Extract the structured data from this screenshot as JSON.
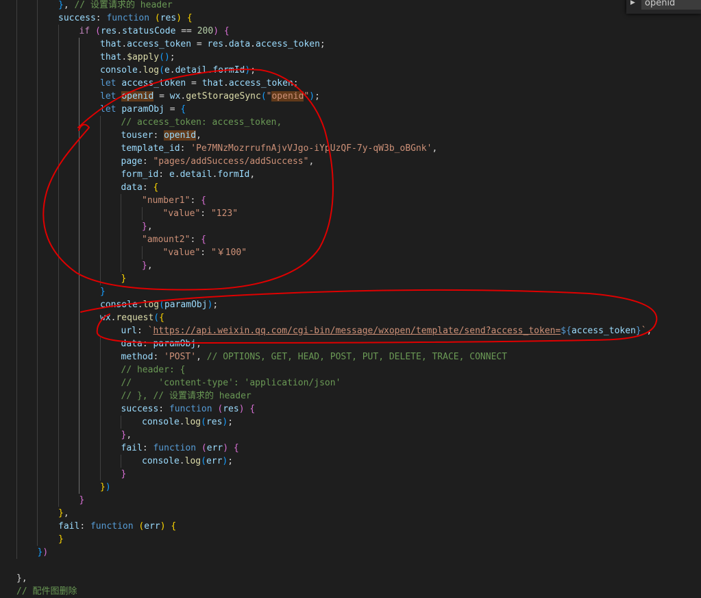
{
  "editor": {
    "lines": [
      [
        {
          "t": "}",
          "c": "br3"
        },
        {
          "t": ", ",
          "c": "pl"
        },
        {
          "t": "// 设置请求的 header",
          "c": "cmt"
        }
      ],
      [
        {
          "t": "success",
          "c": "var"
        },
        {
          "t": ": ",
          "c": "pl"
        },
        {
          "t": "function",
          "c": "kw"
        },
        {
          "t": " ",
          "c": "pl"
        },
        {
          "t": "(",
          "c": "br1"
        },
        {
          "t": "res",
          "c": "var"
        },
        {
          "t": ")",
          "c": "br1"
        },
        {
          "t": " ",
          "c": "pl"
        },
        {
          "t": "{",
          "c": "br1"
        }
      ],
      [
        {
          "t": "if",
          "c": "ctl"
        },
        {
          "t": " ",
          "c": "pl"
        },
        {
          "t": "(",
          "c": "br2"
        },
        {
          "t": "res",
          "c": "var"
        },
        {
          "t": ".",
          "c": "pl"
        },
        {
          "t": "statusCode",
          "c": "var"
        },
        {
          "t": " == ",
          "c": "pl"
        },
        {
          "t": "200",
          "c": "num"
        },
        {
          "t": ")",
          "c": "br2"
        },
        {
          "t": " ",
          "c": "pl"
        },
        {
          "t": "{",
          "c": "br2"
        }
      ],
      [
        {
          "t": "that",
          "c": "var"
        },
        {
          "t": ".",
          "c": "pl"
        },
        {
          "t": "access_token",
          "c": "var"
        },
        {
          "t": " = ",
          "c": "pl"
        },
        {
          "t": "res",
          "c": "var"
        },
        {
          "t": ".",
          "c": "pl"
        },
        {
          "t": "data",
          "c": "var"
        },
        {
          "t": ".",
          "c": "pl"
        },
        {
          "t": "access_token",
          "c": "var"
        },
        {
          "t": ";",
          "c": "pl"
        }
      ],
      [
        {
          "t": "that",
          "c": "var"
        },
        {
          "t": ".",
          "c": "pl"
        },
        {
          "t": "$apply",
          "c": "fn"
        },
        {
          "t": "(",
          "c": "br3"
        },
        {
          "t": ")",
          "c": "br3"
        },
        {
          "t": ";",
          "c": "pl"
        }
      ],
      [
        {
          "t": "console",
          "c": "var"
        },
        {
          "t": ".",
          "c": "pl"
        },
        {
          "t": "log",
          "c": "fn"
        },
        {
          "t": "(",
          "c": "br3"
        },
        {
          "t": "e",
          "c": "var"
        },
        {
          "t": ".",
          "c": "pl"
        },
        {
          "t": "detail",
          "c": "var"
        },
        {
          "t": ".",
          "c": "pl"
        },
        {
          "t": "formId",
          "c": "var"
        },
        {
          "t": ")",
          "c": "br3"
        },
        {
          "t": ";",
          "c": "pl"
        }
      ],
      [
        {
          "t": "let",
          "c": "kw"
        },
        {
          "t": " ",
          "c": "pl"
        },
        {
          "t": "access_token",
          "c": "var"
        },
        {
          "t": " = ",
          "c": "pl"
        },
        {
          "t": "that",
          "c": "var"
        },
        {
          "t": ".",
          "c": "pl"
        },
        {
          "t": "access_token",
          "c": "var"
        },
        {
          "t": ";",
          "c": "pl"
        }
      ],
      [
        {
          "t": "let",
          "c": "kw"
        },
        {
          "t": " ",
          "c": "pl"
        },
        {
          "t": "openid",
          "c": "var",
          "h": 1
        },
        {
          "t": " = ",
          "c": "pl"
        },
        {
          "t": "wx",
          "c": "var"
        },
        {
          "t": ".",
          "c": "pl"
        },
        {
          "t": "getStorageSync",
          "c": "fn"
        },
        {
          "t": "(",
          "c": "br3"
        },
        {
          "t": "\"",
          "c": "str"
        },
        {
          "t": "openid",
          "c": "str",
          "h": 1
        },
        {
          "t": "\"",
          "c": "str"
        },
        {
          "t": ")",
          "c": "br3"
        },
        {
          "t": ";",
          "c": "pl"
        }
      ],
      [
        {
          "t": "let",
          "c": "kw"
        },
        {
          "t": " ",
          "c": "pl"
        },
        {
          "t": "paramObj",
          "c": "var"
        },
        {
          "t": " = ",
          "c": "pl"
        },
        {
          "t": "{",
          "c": "br3"
        }
      ],
      [
        {
          "t": "// access_token: access_token,",
          "c": "cmt"
        }
      ],
      [
        {
          "t": "touser",
          "c": "var"
        },
        {
          "t": ": ",
          "c": "pl"
        },
        {
          "t": "openid",
          "c": "var",
          "h": 1
        },
        {
          "t": ",",
          "c": "pl"
        }
      ],
      [
        {
          "t": "template_id",
          "c": "var"
        },
        {
          "t": ": ",
          "c": "pl"
        },
        {
          "t": "'Pe7MNzMozrrufnAjvVJgo-iYpUzQF-7y-qW3b_oBGnk'",
          "c": "str"
        },
        {
          "t": ",",
          "c": "pl"
        }
      ],
      [
        {
          "t": "page",
          "c": "var"
        },
        {
          "t": ": ",
          "c": "pl"
        },
        {
          "t": "\"pages/addSuccess/addSuccess\"",
          "c": "str"
        },
        {
          "t": ",",
          "c": "pl"
        }
      ],
      [
        {
          "t": "form_id",
          "c": "var"
        },
        {
          "t": ": ",
          "c": "pl"
        },
        {
          "t": "e",
          "c": "var"
        },
        {
          "t": ".",
          "c": "pl"
        },
        {
          "t": "detail",
          "c": "var"
        },
        {
          "t": ".",
          "c": "pl"
        },
        {
          "t": "formId",
          "c": "var"
        },
        {
          "t": ",",
          "c": "pl"
        }
      ],
      [
        {
          "t": "data",
          "c": "var"
        },
        {
          "t": ": ",
          "c": "pl"
        },
        {
          "t": "{",
          "c": "br1"
        }
      ],
      [
        {
          "t": "\"number1\"",
          "c": "str"
        },
        {
          "t": ": ",
          "c": "pl"
        },
        {
          "t": "{",
          "c": "br2"
        }
      ],
      [
        {
          "t": "\"value\"",
          "c": "str"
        },
        {
          "t": ": ",
          "c": "pl"
        },
        {
          "t": "\"123\"",
          "c": "str"
        }
      ],
      [
        {
          "t": "}",
          "c": "br2"
        },
        {
          "t": ",",
          "c": "pl"
        }
      ],
      [
        {
          "t": "\"amount2\"",
          "c": "str"
        },
        {
          "t": ": ",
          "c": "pl"
        },
        {
          "t": "{",
          "c": "br2"
        }
      ],
      [
        {
          "t": "\"value\"",
          "c": "str"
        },
        {
          "t": ": ",
          "c": "pl"
        },
        {
          "t": "\"￥100\"",
          "c": "str"
        }
      ],
      [
        {
          "t": "}",
          "c": "br2"
        },
        {
          "t": ",",
          "c": "pl"
        }
      ],
      [
        {
          "t": "}",
          "c": "br1"
        }
      ],
      [
        {
          "t": "}",
          "c": "br3"
        }
      ],
      [
        {
          "t": "console",
          "c": "var"
        },
        {
          "t": ".",
          "c": "pl"
        },
        {
          "t": "log",
          "c": "fn"
        },
        {
          "t": "(",
          "c": "br3"
        },
        {
          "t": "paramObj",
          "c": "var"
        },
        {
          "t": ")",
          "c": "br3"
        },
        {
          "t": ";",
          "c": "pl"
        }
      ],
      [
        {
          "t": "wx",
          "c": "var"
        },
        {
          "t": ".",
          "c": "pl"
        },
        {
          "t": "request",
          "c": "fn"
        },
        {
          "t": "(",
          "c": "br3"
        },
        {
          "t": "{",
          "c": "br1"
        }
      ],
      [
        {
          "t": "url",
          "c": "var"
        },
        {
          "t": ": ",
          "c": "pl"
        },
        {
          "t": "`",
          "c": "str"
        },
        {
          "t": "https://api.weixin.qq.com/cgi-bin/message/wxopen/template/send?access_token=",
          "c": "url"
        },
        {
          "t": "${",
          "c": "tmp"
        },
        {
          "t": "access_token",
          "c": "var"
        },
        {
          "t": "}",
          "c": "tmp"
        },
        {
          "t": "`",
          "c": "str"
        },
        {
          "t": ",",
          "c": "pl"
        }
      ],
      [
        {
          "t": "data",
          "c": "var"
        },
        {
          "t": ": ",
          "c": "pl"
        },
        {
          "t": "paramObj",
          "c": "var"
        },
        {
          "t": ",",
          "c": "pl"
        }
      ],
      [
        {
          "t": "method",
          "c": "var"
        },
        {
          "t": ": ",
          "c": "pl"
        },
        {
          "t": "'POST'",
          "c": "str"
        },
        {
          "t": ", ",
          "c": "pl"
        },
        {
          "t": "// OPTIONS, GET, HEAD, POST, PUT, DELETE, TRACE, CONNECT",
          "c": "cmt"
        }
      ],
      [
        {
          "t": "// header: {",
          "c": "cmt"
        }
      ],
      [
        {
          "t": "//     'content-type': 'application/json'",
          "c": "cmt"
        }
      ],
      [
        {
          "t": "// }, // 设置请求的 header",
          "c": "cmt"
        }
      ],
      [
        {
          "t": "success",
          "c": "var"
        },
        {
          "t": ": ",
          "c": "pl"
        },
        {
          "t": "function",
          "c": "kw"
        },
        {
          "t": " ",
          "c": "pl"
        },
        {
          "t": "(",
          "c": "br2"
        },
        {
          "t": "res",
          "c": "var"
        },
        {
          "t": ")",
          "c": "br2"
        },
        {
          "t": " ",
          "c": "pl"
        },
        {
          "t": "{",
          "c": "br2"
        }
      ],
      [
        {
          "t": "console",
          "c": "var"
        },
        {
          "t": ".",
          "c": "pl"
        },
        {
          "t": "log",
          "c": "fn"
        },
        {
          "t": "(",
          "c": "br3"
        },
        {
          "t": "res",
          "c": "var"
        },
        {
          "t": ")",
          "c": "br3"
        },
        {
          "t": ";",
          "c": "pl"
        }
      ],
      [
        {
          "t": "}",
          "c": "br2"
        },
        {
          "t": ",",
          "c": "pl"
        }
      ],
      [
        {
          "t": "fail",
          "c": "var"
        },
        {
          "t": ": ",
          "c": "pl"
        },
        {
          "t": "function",
          "c": "kw"
        },
        {
          "t": " ",
          "c": "pl"
        },
        {
          "t": "(",
          "c": "br2"
        },
        {
          "t": "err",
          "c": "var"
        },
        {
          "t": ")",
          "c": "br2"
        },
        {
          "t": " ",
          "c": "pl"
        },
        {
          "t": "{",
          "c": "br2"
        }
      ],
      [
        {
          "t": "console",
          "c": "var"
        },
        {
          "t": ".",
          "c": "pl"
        },
        {
          "t": "log",
          "c": "fn"
        },
        {
          "t": "(",
          "c": "br3"
        },
        {
          "t": "err",
          "c": "var"
        },
        {
          "t": ")",
          "c": "br3"
        },
        {
          "t": ";",
          "c": "pl"
        }
      ],
      [
        {
          "t": "}",
          "c": "br2"
        }
      ],
      [
        {
          "t": "}",
          "c": "br1"
        },
        {
          "t": ")",
          "c": "br3"
        }
      ],
      [
        {
          "t": "}",
          "c": "br2"
        }
      ],
      [
        {
          "t": "}",
          "c": "br1"
        },
        {
          "t": ",",
          "c": "pl"
        }
      ],
      [
        {
          "t": "fail",
          "c": "var"
        },
        {
          "t": ": ",
          "c": "pl"
        },
        {
          "t": "function",
          "c": "kw"
        },
        {
          "t": " ",
          "c": "pl"
        },
        {
          "t": "(",
          "c": "br1"
        },
        {
          "t": "err",
          "c": "var"
        },
        {
          "t": ")",
          "c": "br1"
        },
        {
          "t": " ",
          "c": "pl"
        },
        {
          "t": "{",
          "c": "br1"
        }
      ],
      [
        {
          "t": "}",
          "c": "br1"
        }
      ],
      [
        {
          "t": "}",
          "c": "br3"
        },
        {
          "t": ")",
          "c": "br2"
        }
      ],
      [],
      [
        {
          "t": "}",
          "c": "pl"
        },
        {
          "t": ",",
          "c": "pl"
        }
      ],
      [
        {
          "t": "// 配件图删除",
          "c": "cmt"
        }
      ]
    ]
  },
  "find_widget": {
    "toggle_icon": "chevron-right-icon",
    "query": "openid"
  },
  "colors": {
    "background": "#1e1e1e",
    "annotation_ink": "#e00000",
    "word_highlight": "#613a1a"
  }
}
